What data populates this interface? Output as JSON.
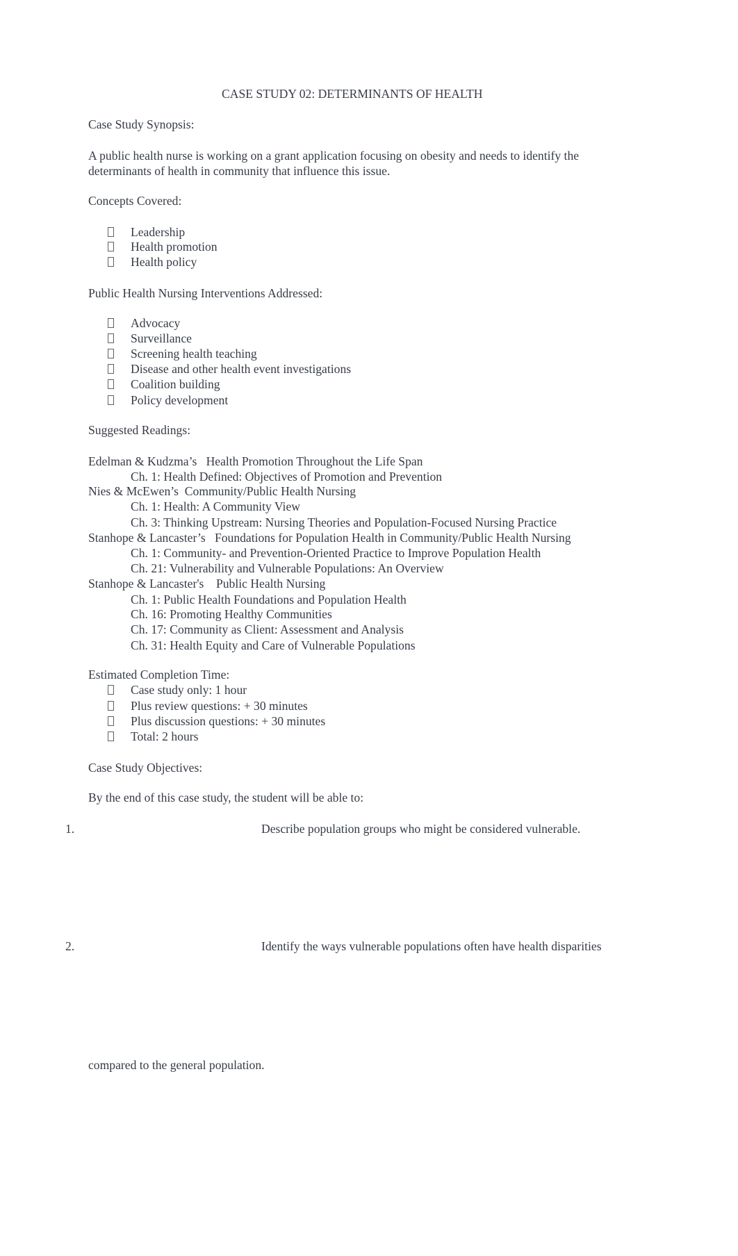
{
  "title": "CASE STUDY 02: DETERMINANTS OF HEALTH",
  "synopsis": {
    "heading": "Case Study Synopsis:",
    "lines": [
      "A public health nurse is working on a grant application focusing on obesity and needs to identify the",
      "determinants of health in community that influence this issue."
    ]
  },
  "concepts": {
    "heading": "Concepts Covered:",
    "items": [
      "Leadership",
      "Health promotion",
      "Health policy"
    ]
  },
  "interventions": {
    "heading": "Public Health Nursing Interventions Addressed:",
    "items": [
      "Advocacy",
      "Surveillance",
      "Screening health teaching",
      "Disease and other health event investigations",
      "Coalition building",
      "Policy development"
    ]
  },
  "readings": {
    "heading": "Suggested Readings:",
    "books": [
      {
        "author": "Edelman & Kudzma’s",
        "title": "Health Promotion Throughout the Life Span",
        "chapters": [
          "Ch. 1: Health Defined: Objectives of Promotion and Prevention"
        ]
      },
      {
        "author": "Nies & McEwen’s",
        "title": "Community/Public Health Nursing",
        "chapters": [
          "Ch. 1: Health: A Community View",
          "Ch. 3: Thinking Upstream: Nursing Theories and Population-Focused Nursing Practice"
        ]
      },
      {
        "author": "Stanhope & Lancaster’s",
        "title": "Foundations for Population Health in Community/Public Health Nursing",
        "chapters": [
          "Ch. 1: Community- and Prevention-Oriented Practice to Improve Population Health",
          "Ch. 21: Vulnerability and Vulnerable Populations: An Overview"
        ]
      },
      {
        "author": "Stanhope & Lancaster's",
        "title": "Public Health Nursing",
        "chapters": [
          "Ch. 1: Public Health Foundations and Population Health",
          "Ch. 16: Promoting Healthy Communities",
          "Ch. 17: Community as Client: Assessment and Analysis",
          "Ch. 31: Health Equity and Care of Vulnerable Populations"
        ]
      }
    ]
  },
  "completion": {
    "heading": "Estimated Completion Time:",
    "items": [
      "Case study only: 1 hour",
      "Plus review questions: + 30 minutes",
      "Plus discussion questions: + 30 minutes",
      "Total: 2 hours"
    ]
  },
  "objectives": {
    "heading": "Case Study Objectives:",
    "intro": "By the end of this case study, the student will be able to:",
    "items": [
      {
        "number": "1.",
        "text": "Describe population groups who might be considered vulnerable."
      },
      {
        "number": "2.",
        "text": "Identify the ways vulnerable populations often have health disparities",
        "continuation": "compared to the general population."
      }
    ]
  }
}
